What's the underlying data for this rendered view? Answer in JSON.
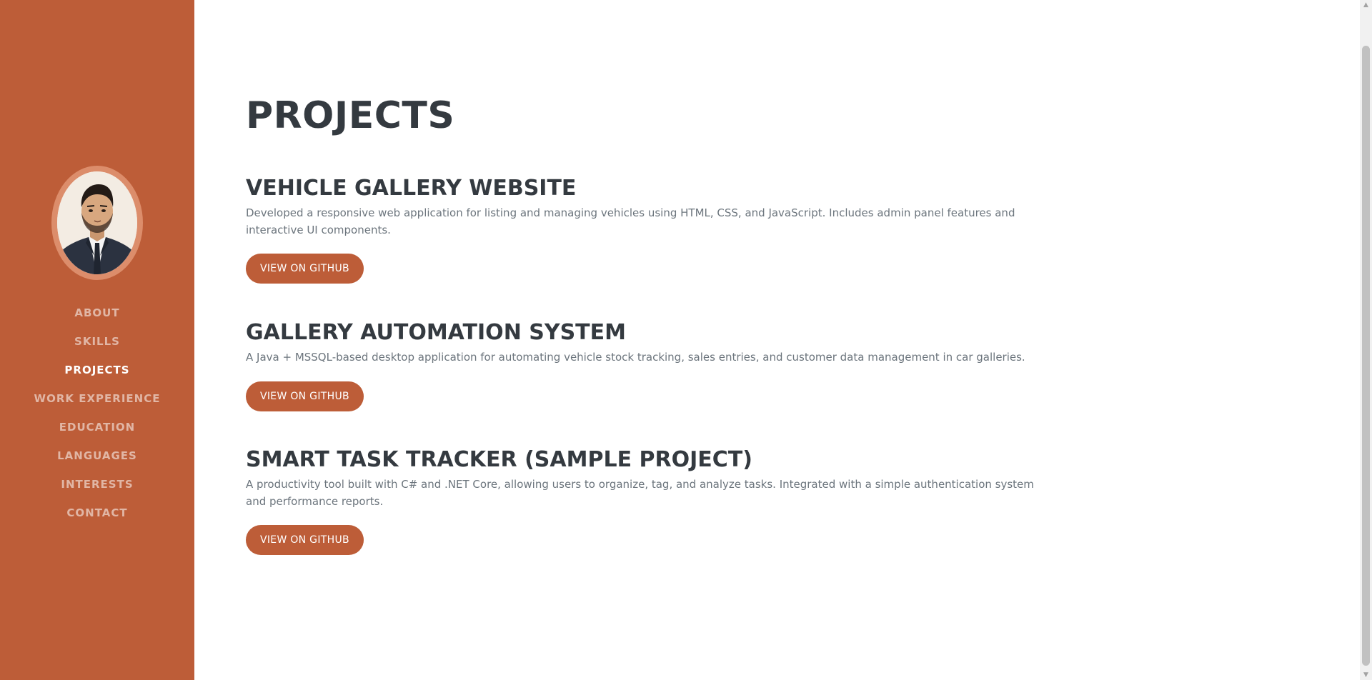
{
  "sidebar": {
    "avatar_alt": "Profile photo",
    "nav": [
      {
        "label": "ABOUT",
        "active": false
      },
      {
        "label": "SKILLS",
        "active": false
      },
      {
        "label": "PROJECTS",
        "active": true
      },
      {
        "label": "WORK EXPERIENCE",
        "active": false
      },
      {
        "label": "EDUCATION",
        "active": false
      },
      {
        "label": "LANGUAGES",
        "active": false
      },
      {
        "label": "INTERESTS",
        "active": false
      },
      {
        "label": "CONTACT",
        "active": false
      }
    ]
  },
  "main": {
    "title": "PROJECTS",
    "projects": [
      {
        "title": "VEHICLE GALLERY WEBSITE",
        "description": "Developed a responsive web application for listing and managing vehicles using HTML, CSS, and JavaScript. Includes admin panel features and interactive UI components.",
        "button_label": "VIEW ON GITHUB"
      },
      {
        "title": "GALLERY AUTOMATION SYSTEM",
        "description": "A Java + MSSQL-based desktop application for automating vehicle stock tracking, sales entries, and customer data management in car galleries.",
        "button_label": "VIEW ON GITHUB"
      },
      {
        "title": "SMART TASK TRACKER (SAMPLE PROJECT)",
        "description": "A productivity tool built with C# and .NET Core, allowing users to organize, tag, and analyze tasks. Integrated with a simple authentication system and performance reports.",
        "button_label": "VIEW ON GITHUB"
      }
    ]
  },
  "colors": {
    "sidebar_bg": "#bd5d38",
    "button_bg": "#bd5d38",
    "heading": "#343a40",
    "body_text": "#6c757d"
  },
  "icons": {
    "scroll_up": "scroll-up-arrow-icon",
    "scroll_down": "scroll-down-arrow-icon"
  }
}
